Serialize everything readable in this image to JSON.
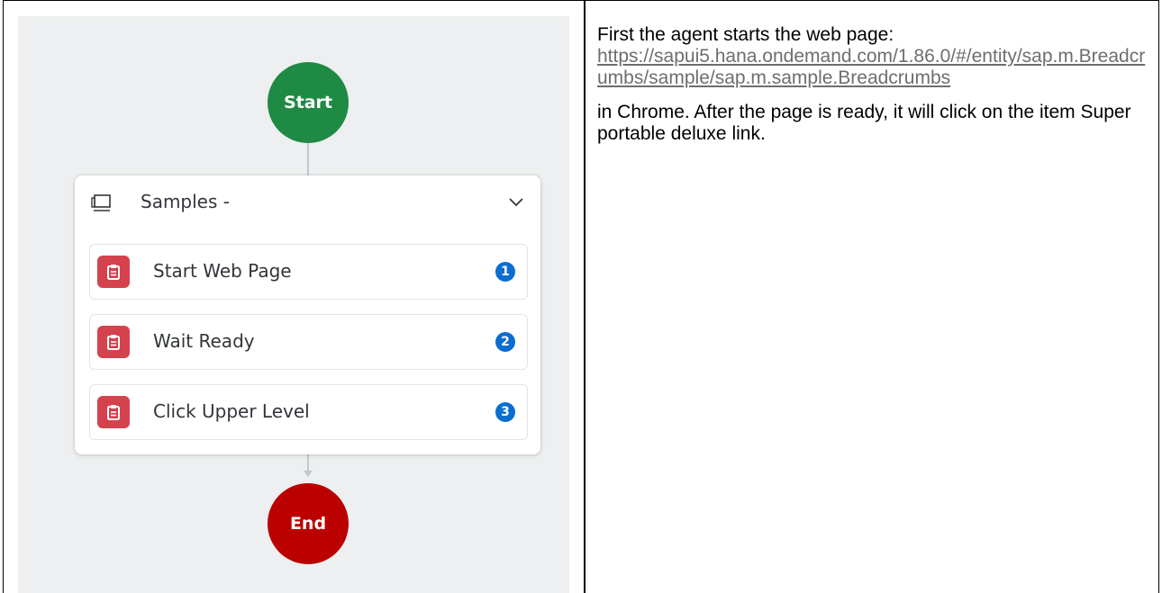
{
  "workflow": {
    "start_label": "Start",
    "end_label": "End",
    "group_title": "Samples -",
    "steps": [
      {
        "label": "Start Web Page",
        "number": "1"
      },
      {
        "label": "Wait Ready",
        "number": "2"
      },
      {
        "label": "Click Upper Level",
        "number": "3"
      }
    ],
    "colors": {
      "start": "#1f8a44",
      "end": "#bb0000",
      "step_icon": "#d4424e",
      "badge": "#0a6ed1"
    },
    "icons": {
      "group": "monitor-icon",
      "collapse": "chevron-down-icon",
      "step": "clipboard-icon"
    }
  },
  "description": {
    "intro": "First the agent starts the web page:",
    "url": "https://sapui5.hana.ondemand.com/1.86.0/#/entity/sap.m.Breadcrumbs/sample/sap.m.sample.Breadcrumbs",
    "outro": "in Chrome. After the page is ready, it will click on the item Super portable deluxe link."
  }
}
